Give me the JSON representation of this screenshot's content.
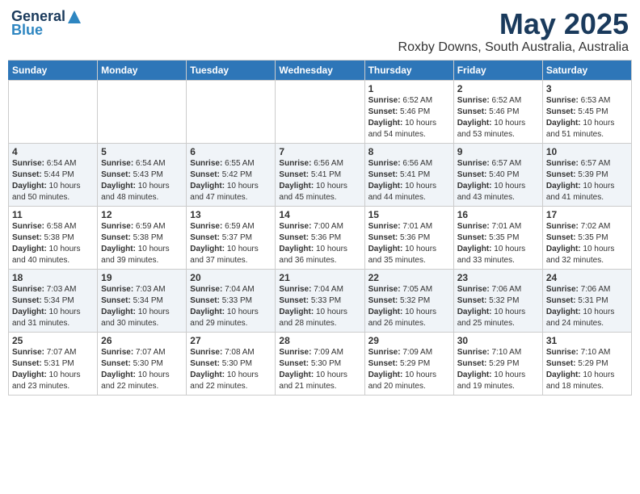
{
  "header": {
    "logo_line1": "General",
    "logo_line2": "Blue",
    "month": "May 2025",
    "location": "Roxby Downs, South Australia, Australia"
  },
  "days_of_week": [
    "Sunday",
    "Monday",
    "Tuesday",
    "Wednesday",
    "Thursday",
    "Friday",
    "Saturday"
  ],
  "weeks": [
    [
      {
        "day": "",
        "info": ""
      },
      {
        "day": "",
        "info": ""
      },
      {
        "day": "",
        "info": ""
      },
      {
        "day": "",
        "info": ""
      },
      {
        "day": "1",
        "info": "Sunrise: 6:52 AM\nSunset: 5:46 PM\nDaylight: 10 hours\nand 54 minutes."
      },
      {
        "day": "2",
        "info": "Sunrise: 6:52 AM\nSunset: 5:46 PM\nDaylight: 10 hours\nand 53 minutes."
      },
      {
        "day": "3",
        "info": "Sunrise: 6:53 AM\nSunset: 5:45 PM\nDaylight: 10 hours\nand 51 minutes."
      }
    ],
    [
      {
        "day": "4",
        "info": "Sunrise: 6:54 AM\nSunset: 5:44 PM\nDaylight: 10 hours\nand 50 minutes."
      },
      {
        "day": "5",
        "info": "Sunrise: 6:54 AM\nSunset: 5:43 PM\nDaylight: 10 hours\nand 48 minutes."
      },
      {
        "day": "6",
        "info": "Sunrise: 6:55 AM\nSunset: 5:42 PM\nDaylight: 10 hours\nand 47 minutes."
      },
      {
        "day": "7",
        "info": "Sunrise: 6:56 AM\nSunset: 5:41 PM\nDaylight: 10 hours\nand 45 minutes."
      },
      {
        "day": "8",
        "info": "Sunrise: 6:56 AM\nSunset: 5:41 PM\nDaylight: 10 hours\nand 44 minutes."
      },
      {
        "day": "9",
        "info": "Sunrise: 6:57 AM\nSunset: 5:40 PM\nDaylight: 10 hours\nand 43 minutes."
      },
      {
        "day": "10",
        "info": "Sunrise: 6:57 AM\nSunset: 5:39 PM\nDaylight: 10 hours\nand 41 minutes."
      }
    ],
    [
      {
        "day": "11",
        "info": "Sunrise: 6:58 AM\nSunset: 5:38 PM\nDaylight: 10 hours\nand 40 minutes."
      },
      {
        "day": "12",
        "info": "Sunrise: 6:59 AM\nSunset: 5:38 PM\nDaylight: 10 hours\nand 39 minutes."
      },
      {
        "day": "13",
        "info": "Sunrise: 6:59 AM\nSunset: 5:37 PM\nDaylight: 10 hours\nand 37 minutes."
      },
      {
        "day": "14",
        "info": "Sunrise: 7:00 AM\nSunset: 5:36 PM\nDaylight: 10 hours\nand 36 minutes."
      },
      {
        "day": "15",
        "info": "Sunrise: 7:01 AM\nSunset: 5:36 PM\nDaylight: 10 hours\nand 35 minutes."
      },
      {
        "day": "16",
        "info": "Sunrise: 7:01 AM\nSunset: 5:35 PM\nDaylight: 10 hours\nand 33 minutes."
      },
      {
        "day": "17",
        "info": "Sunrise: 7:02 AM\nSunset: 5:35 PM\nDaylight: 10 hours\nand 32 minutes."
      }
    ],
    [
      {
        "day": "18",
        "info": "Sunrise: 7:03 AM\nSunset: 5:34 PM\nDaylight: 10 hours\nand 31 minutes."
      },
      {
        "day": "19",
        "info": "Sunrise: 7:03 AM\nSunset: 5:34 PM\nDaylight: 10 hours\nand 30 minutes."
      },
      {
        "day": "20",
        "info": "Sunrise: 7:04 AM\nSunset: 5:33 PM\nDaylight: 10 hours\nand 29 minutes."
      },
      {
        "day": "21",
        "info": "Sunrise: 7:04 AM\nSunset: 5:33 PM\nDaylight: 10 hours\nand 28 minutes."
      },
      {
        "day": "22",
        "info": "Sunrise: 7:05 AM\nSunset: 5:32 PM\nDaylight: 10 hours\nand 26 minutes."
      },
      {
        "day": "23",
        "info": "Sunrise: 7:06 AM\nSunset: 5:32 PM\nDaylight: 10 hours\nand 25 minutes."
      },
      {
        "day": "24",
        "info": "Sunrise: 7:06 AM\nSunset: 5:31 PM\nDaylight: 10 hours\nand 24 minutes."
      }
    ],
    [
      {
        "day": "25",
        "info": "Sunrise: 7:07 AM\nSunset: 5:31 PM\nDaylight: 10 hours\nand 23 minutes."
      },
      {
        "day": "26",
        "info": "Sunrise: 7:07 AM\nSunset: 5:30 PM\nDaylight: 10 hours\nand 22 minutes."
      },
      {
        "day": "27",
        "info": "Sunrise: 7:08 AM\nSunset: 5:30 PM\nDaylight: 10 hours\nand 22 minutes."
      },
      {
        "day": "28",
        "info": "Sunrise: 7:09 AM\nSunset: 5:30 PM\nDaylight: 10 hours\nand 21 minutes."
      },
      {
        "day": "29",
        "info": "Sunrise: 7:09 AM\nSunset: 5:29 PM\nDaylight: 10 hours\nand 20 minutes."
      },
      {
        "day": "30",
        "info": "Sunrise: 7:10 AM\nSunset: 5:29 PM\nDaylight: 10 hours\nand 19 minutes."
      },
      {
        "day": "31",
        "info": "Sunrise: 7:10 AM\nSunset: 5:29 PM\nDaylight: 10 hours\nand 18 minutes."
      }
    ]
  ]
}
